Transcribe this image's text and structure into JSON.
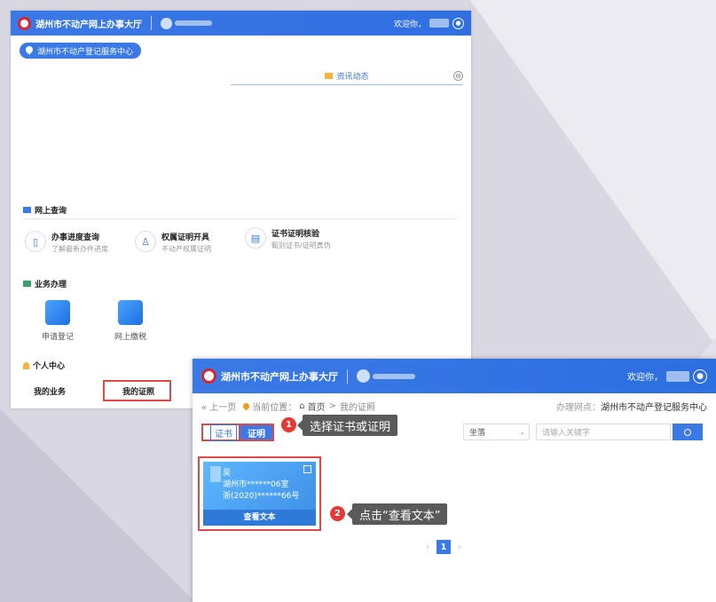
{
  "back_window": {
    "header": {
      "title": "湖州市不动产网上办事大厅",
      "welcome": "欢迎你，"
    },
    "location_pill": "湖州市不动产登记服务中心",
    "news": {
      "title": "资讯动态",
      "collapse_glyph": "⊖"
    },
    "online_query": {
      "title": "网上查询",
      "services": [
        {
          "title": "办事进度查询",
          "desc": "了解最新办件进度"
        },
        {
          "title": "权属证明开具",
          "desc": "不动产权属证明"
        },
        {
          "title": "证书证明核验",
          "desc": "甄别证书/证明真伪"
        }
      ]
    },
    "business": {
      "title": "业务办理",
      "items": [
        {
          "label": "申请登记"
        },
        {
          "label": "网上缴税"
        }
      ]
    },
    "personal": {
      "title": "个人中心",
      "my_business": "我的业务",
      "my_certificates": "我的证照"
    }
  },
  "front_window": {
    "header": {
      "title": "湖州市不动产网上办事大厅",
      "welcome": "欢迎你，"
    },
    "breadcrumb": {
      "back": "« 上一页",
      "location_label": "当前位置：",
      "home": "首页",
      "sep": ">",
      "current": "我的证照",
      "office_label": "办理网点：",
      "office": "湖州市不动产登记服务中心"
    },
    "tabs": {
      "cert": "证书",
      "proof": "证明"
    },
    "filter": {
      "select_value": "坐落",
      "search_placeholder": "请输入关键字"
    },
    "card": {
      "name": "吴",
      "address": "湖州市******06室",
      "number": "浙(2020)******66号",
      "view_button": "查看文本"
    },
    "annotations": [
      {
        "num": "1",
        "text": "选择证书或证明"
      },
      {
        "num": "2",
        "text": "点击“查看文本”"
      }
    ],
    "pager": {
      "prev": "‹",
      "current": "1",
      "next": "›"
    }
  }
}
